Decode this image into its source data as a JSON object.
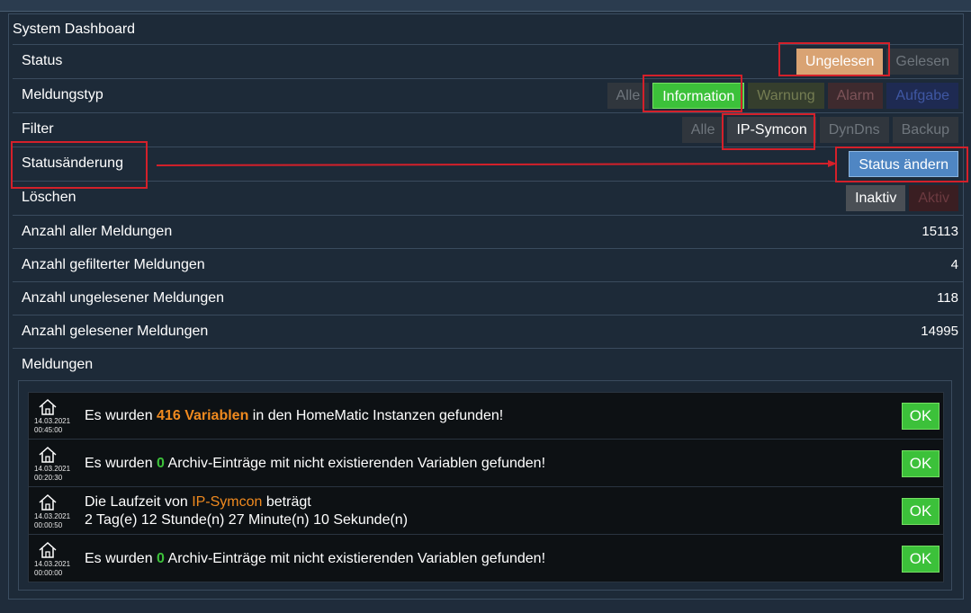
{
  "dashboard": {
    "title": "System Dashboard"
  },
  "status": {
    "label": "Status",
    "options": [
      "Ungelesen",
      "Gelesen"
    ],
    "selected": "Ungelesen"
  },
  "meldungstyp": {
    "label": "Meldungstyp",
    "options": [
      "Alle",
      "Information",
      "Warnung",
      "Alarm",
      "Aufgabe"
    ],
    "selected": "Information"
  },
  "filter": {
    "label": "Filter",
    "options": [
      "Alle",
      "IP-Symcon",
      "DynDns",
      "Backup"
    ],
    "selected": "IP-Symcon"
  },
  "statusaenderung": {
    "label": "Statusänderung",
    "button": "Status ändern"
  },
  "loeschen": {
    "label": "Löschen",
    "options": [
      "Inaktiv",
      "Aktiv"
    ],
    "selected": "Inaktiv"
  },
  "stats": [
    {
      "label": "Anzahl aller Meldungen",
      "value": "15113"
    },
    {
      "label": "Anzahl gefilterter Meldungen",
      "value": "4"
    },
    {
      "label": "Anzahl ungelesener Meldungen",
      "value": "118"
    },
    {
      "label": "Anzahl gelesener Meldungen",
      "value": "14995"
    }
  ],
  "meldungen": {
    "label": "Meldungen",
    "ok_label": "OK",
    "items": [
      {
        "date": "14.03.2021",
        "time": "00:45:00",
        "pre": "Es wurden ",
        "hl": "416 Variablen",
        "post": " in den HomeMatic Instanzen gefunden!"
      },
      {
        "date": "14.03.2021",
        "time": "00:20:30",
        "pre": "Es wurden ",
        "hl": "0",
        "post": " Archiv-Einträge mit nicht existierenden Variablen gefunden!"
      },
      {
        "date": "14.03.2021",
        "time": "00:00:50",
        "pre": "Die Laufzeit von ",
        "hl": "IP-Symcon",
        "post": " beträgt",
        "line2": "2 Tag(e) 12 Stunde(n) 27 Minute(n) 10 Sekunde(n)"
      },
      {
        "date": "14.03.2021",
        "time": "00:00:00",
        "pre": "Es wurden ",
        "hl": "0",
        "post": " Archiv-Einträge mit nicht existierenden Variablen gefunden!"
      }
    ]
  },
  "colors": {
    "background": "#1f2c3b",
    "selected_green": "#3cc13a",
    "ungelesen": "#d9a373",
    "status_button": "#4f86c3",
    "highlight": "#f08a1f",
    "annotation_red": "#d4202a"
  }
}
